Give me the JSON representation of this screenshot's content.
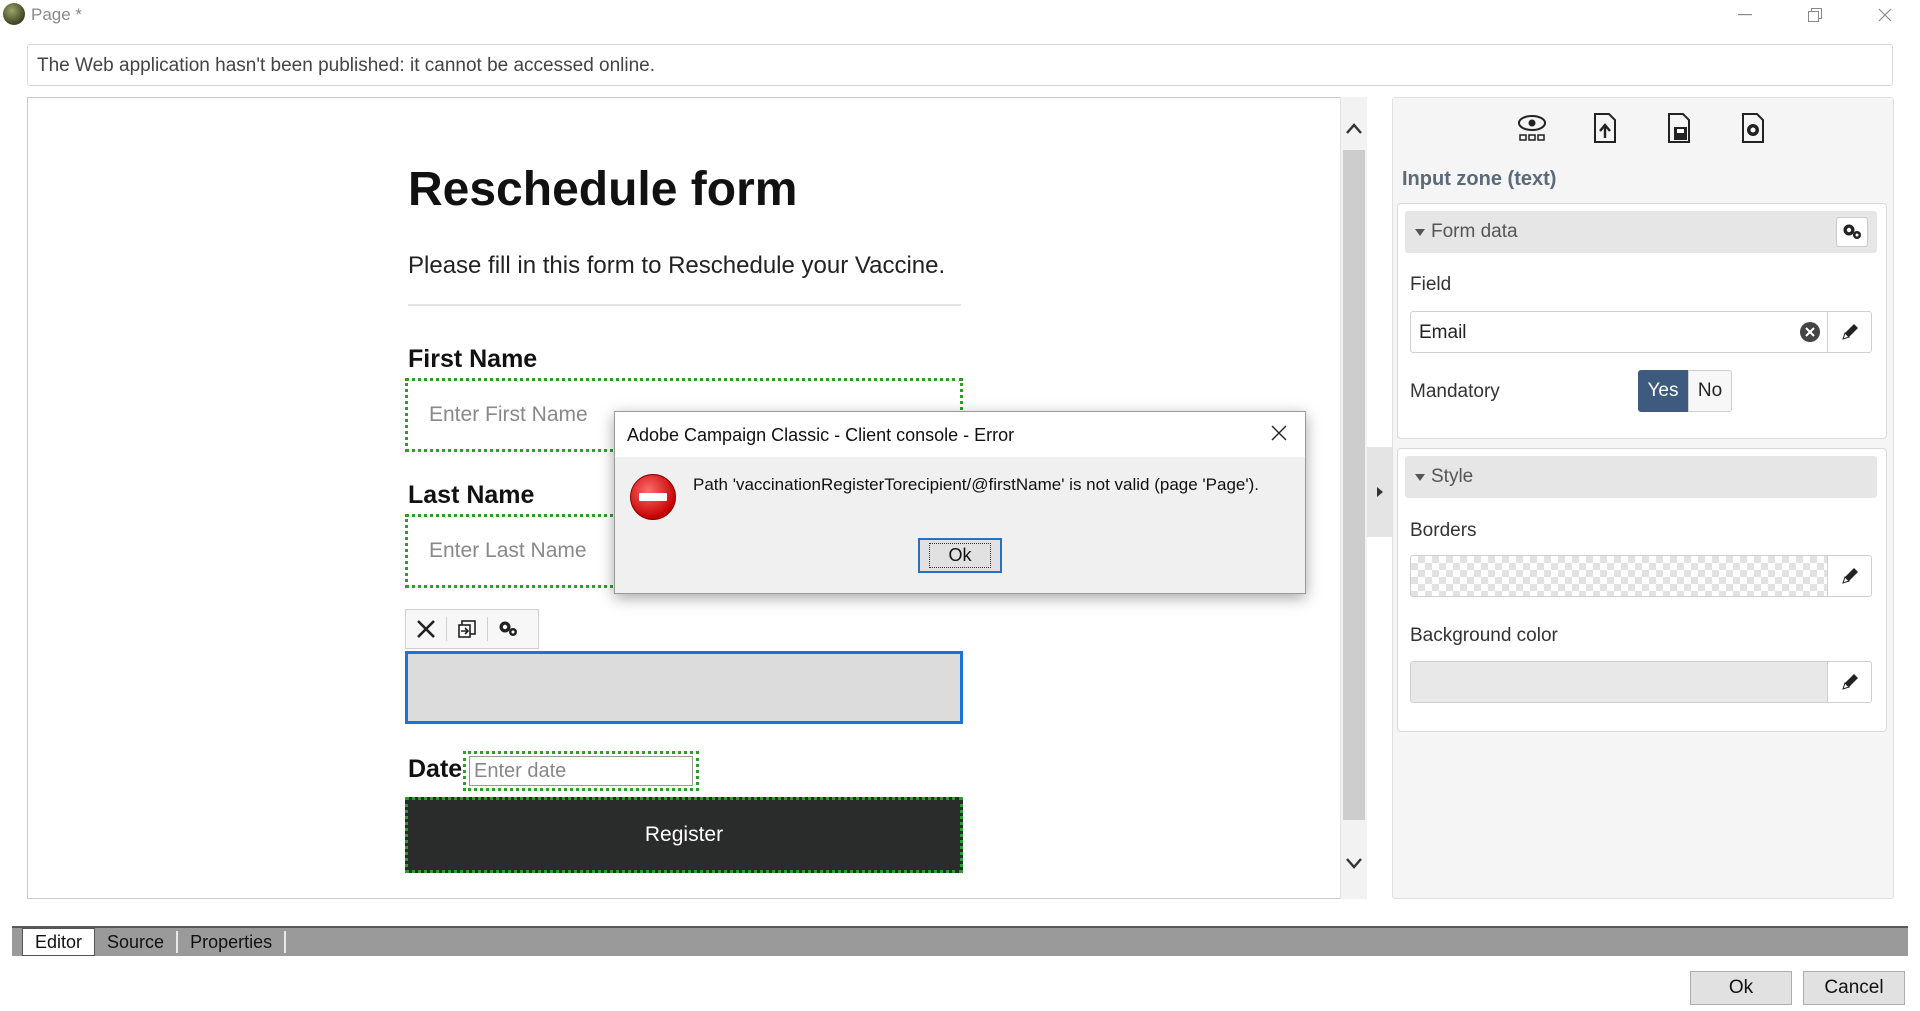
{
  "window": {
    "title": "Page *",
    "icons": [
      "app-icon",
      "minimize-icon",
      "restore-icon",
      "close-icon"
    ]
  },
  "banner": {
    "text": "The Web application hasn't been published: it cannot be accessed online."
  },
  "form": {
    "title": "Reschedule form",
    "description": "Please fill in this form to Reschedule your Vaccine.",
    "first_name_label": "First Name",
    "first_name_placeholder": "Enter First Name",
    "last_name_label": "Last Name",
    "last_name_placeholder": "Enter Last Name",
    "date_label": "Date",
    "date_placeholder": "Enter date",
    "register_label": "Register",
    "toolbar_icons": [
      "delete-icon",
      "move-icon",
      "settings-gear-icon"
    ]
  },
  "dialog": {
    "title": "Adobe Campaign Classic - Client console - Error",
    "message": "Path 'vaccinationRegisterTorecipient/@firstName' is not valid (page 'Page').",
    "ok_label": "Ok",
    "icon": "error-stop-icon"
  },
  "right_panel": {
    "toolbar_icons": [
      "preview-eye-icon",
      "page-up-icon",
      "page-save-icon",
      "page-settings-icon"
    ],
    "title": "Input zone (text)",
    "form_data": {
      "header": "Form data",
      "field_label": "Field",
      "field_value": "Email",
      "mandatory_label": "Mandatory",
      "yes_label": "Yes",
      "no_label": "No",
      "mandatory_selected": "Yes"
    },
    "style": {
      "header": "Style",
      "borders_label": "Borders",
      "background_label": "Background color"
    }
  },
  "tabs": [
    {
      "label": "Editor",
      "active": true
    },
    {
      "label": "Source",
      "active": false
    },
    {
      "label": "Properties",
      "active": false
    }
  ],
  "buttons": {
    "ok_label": "Ok",
    "cancel_label": "Cancel"
  },
  "colors": {
    "accent_blue": "#1a73d9",
    "toggle_active": "#3e5a7e",
    "dotted_green": "#2aa02a",
    "register_bg": "#2a2b2b",
    "error_red": "#c40000"
  }
}
